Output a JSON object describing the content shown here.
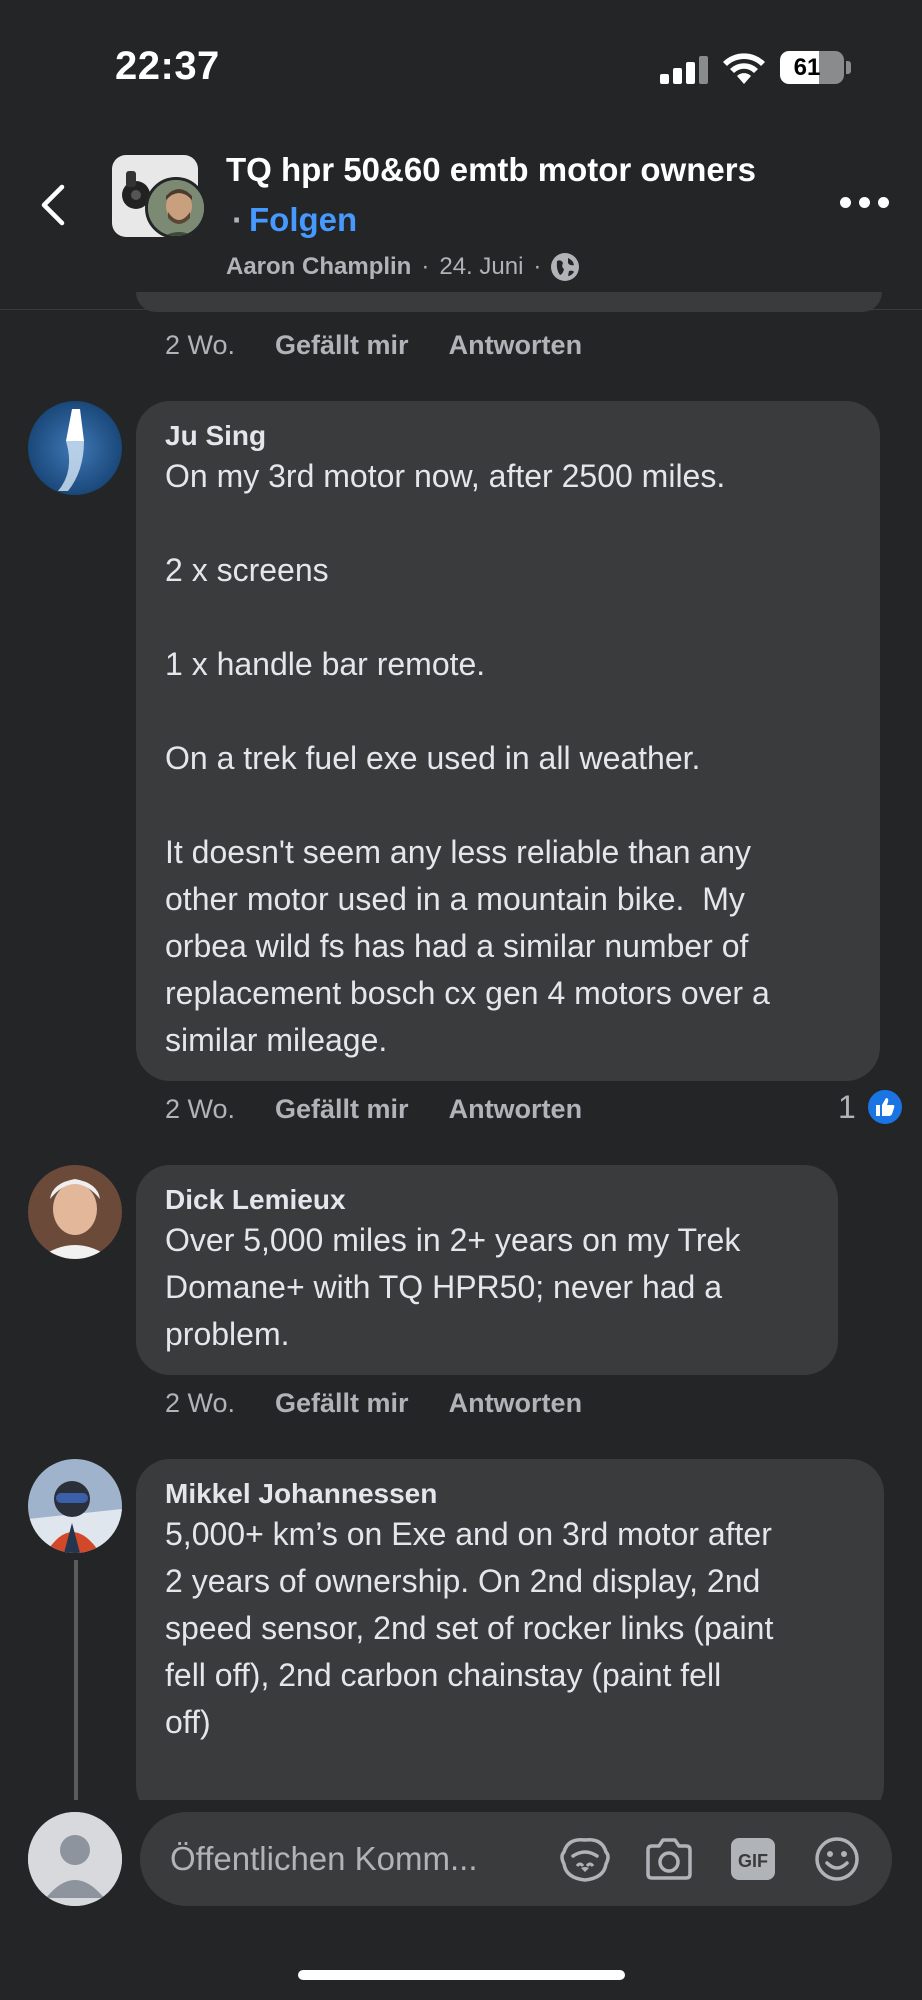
{
  "status_bar": {
    "time": "22:37",
    "battery": "61",
    "battery_level": 0.61
  },
  "header": {
    "group_name": "TQ hpr 50&60 emtb motor owners",
    "follow_separator": "·",
    "follow_label": "Folgen",
    "author": "Aaron Champlin",
    "separator": "·",
    "date": "24. Juni",
    "icons": {
      "back": "chevron-left-icon",
      "privacy": "globe-icon",
      "more": "more-horizontal-icon"
    }
  },
  "previous_comment": {
    "time": "2 Wo.",
    "like": "Gefällt mir",
    "reply": "Antworten"
  },
  "comments": [
    {
      "name": "Ju Sing",
      "text": "On my 3rd motor now, after 2500 miles.\n\n2 x screens\n\n1 x handle bar remote.\n\nOn a trek fuel exe used in all weather.\n\nIt doesn't seem any less reliable than any\nother motor used in a mountain bike.  My\norbea wild fs has had a similar number of\nreplacement bosch cx gen 4 motors over a\nsimilar mileage.",
      "time": "2 Wo.",
      "like": "Gefällt mir",
      "reply": "Antworten",
      "reaction_count": "1",
      "reaction_icon": "thumbs-up-icon"
    },
    {
      "name": "Dick Lemieux",
      "text": "Over 5,000 miles in 2+ years on my Trek\nDomane+ with TQ HPR50; never had a\nproblem.",
      "time": "2 Wo.",
      "like": "Gefällt mir",
      "reply": "Antworten"
    },
    {
      "name": "Mikkel Johannessen",
      "text": "5,000+ km’s on Exe and on 3rd motor after\n2 years of ownership. On 2nd display, 2nd\nspeed sensor, 2nd set of rocker links (paint\nfell off), 2nd carbon chainstay (paint fell\noff)"
    }
  ],
  "composer": {
    "placeholder": "Öffentlichen Komm...",
    "icons": [
      "avatar-sticker-icon",
      "camera-icon",
      "gif-icon",
      "emoji-icon"
    ]
  },
  "colors": {
    "background": "#242526",
    "bubble": "#3a3b3c",
    "link": "#4599ff",
    "like_blue": "#1b74e4"
  }
}
